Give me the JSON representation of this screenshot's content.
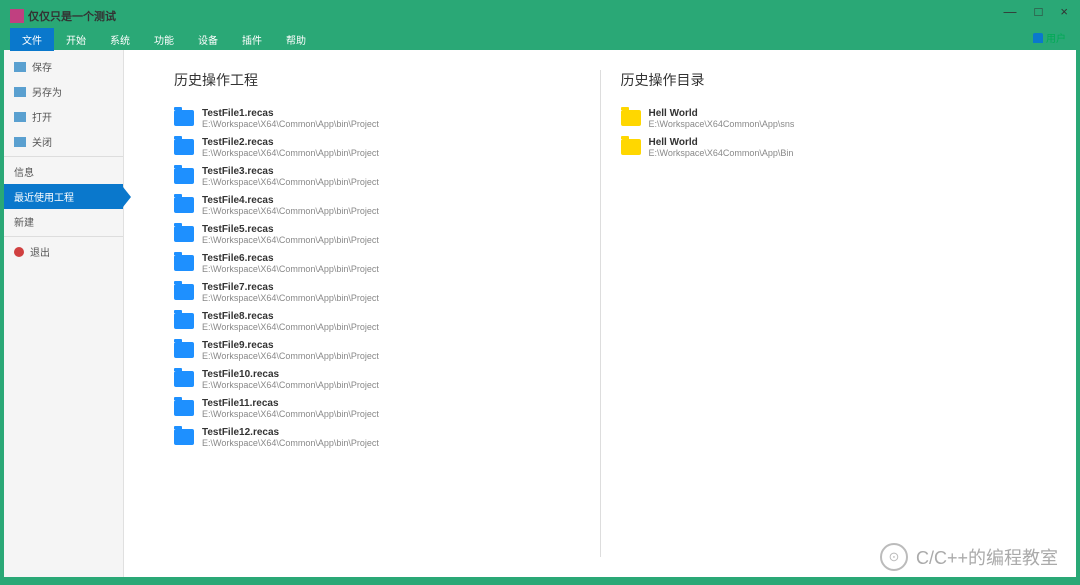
{
  "window": {
    "title": "仅仅只是一个测试"
  },
  "winControls": {
    "min": "—",
    "max": "□",
    "close": "×"
  },
  "menu": {
    "items": [
      "文件",
      "开始",
      "系统",
      "功能",
      "设备",
      "插件",
      "帮助"
    ],
    "activeIndex": 0,
    "user": "用户"
  },
  "sidebar": {
    "groups": [
      [
        {
          "label": "保存",
          "iconClass": "icon-save"
        },
        {
          "label": "另存为",
          "iconClass": "icon-saveas"
        },
        {
          "label": "打开",
          "iconClass": "icon-open"
        },
        {
          "label": "关闭",
          "iconClass": "icon-close"
        }
      ],
      [
        {
          "label": "信息",
          "iconClass": ""
        },
        {
          "label": "最近使用工程",
          "iconClass": "",
          "selected": true
        },
        {
          "label": "新建",
          "iconClass": ""
        }
      ],
      [
        {
          "label": "退出",
          "iconClass": "icon-exit"
        }
      ]
    ]
  },
  "history": {
    "projectsTitle": "历史操作工程",
    "dirsTitle": "历史操作目录",
    "projects": [
      {
        "name": "TestFile1.recas",
        "path": "E:\\Workspace\\X64\\Common\\App\\bin\\Project"
      },
      {
        "name": "TestFile2.recas",
        "path": "E:\\Workspace\\X64\\Common\\App\\bin\\Project"
      },
      {
        "name": "TestFile3.recas",
        "path": "E:\\Workspace\\X64\\Common\\App\\bin\\Project"
      },
      {
        "name": "TestFile4.recas",
        "path": "E:\\Workspace\\X64\\Common\\App\\bin\\Project"
      },
      {
        "name": "TestFile5.recas",
        "path": "E:\\Workspace\\X64\\Common\\App\\bin\\Project"
      },
      {
        "name": "TestFile6.recas",
        "path": "E:\\Workspace\\X64\\Common\\App\\bin\\Project"
      },
      {
        "name": "TestFile7.recas",
        "path": "E:\\Workspace\\X64\\Common\\App\\bin\\Project"
      },
      {
        "name": "TestFile8.recas",
        "path": "E:\\Workspace\\X64\\Common\\App\\bin\\Project"
      },
      {
        "name": "TestFile9.recas",
        "path": "E:\\Workspace\\X64\\Common\\App\\bin\\Project"
      },
      {
        "name": "TestFile10.recas",
        "path": "E:\\Workspace\\X64\\Common\\App\\bin\\Project"
      },
      {
        "name": "TestFile11.recas",
        "path": "E:\\Workspace\\X64\\Common\\App\\bin\\Project"
      },
      {
        "name": "TestFile12.recas",
        "path": "E:\\Workspace\\X64\\Common\\App\\bin\\Project"
      }
    ],
    "dirs": [
      {
        "name": "Hell World",
        "path": "E:\\Workspace\\X64Common\\App\\sns"
      },
      {
        "name": "Hell World",
        "path": "E:\\Workspace\\X64Common\\App\\Bin"
      }
    ]
  },
  "watermark": {
    "text": "C/C++的编程教室",
    "icon": "⊙"
  }
}
